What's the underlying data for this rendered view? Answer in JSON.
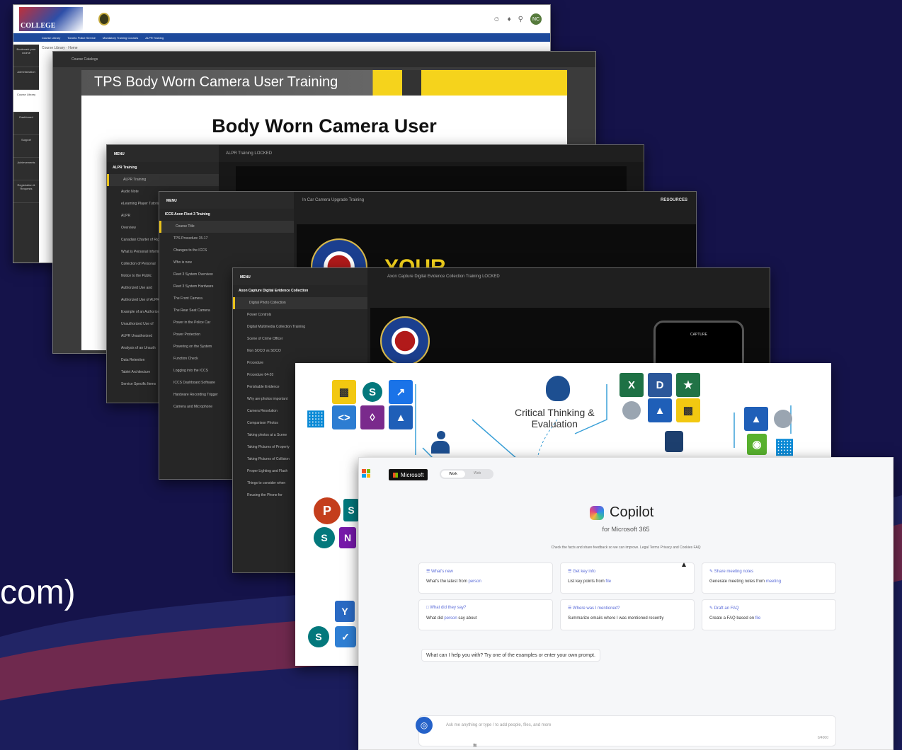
{
  "caption": "com)",
  "colors": {
    "background": "#15134a",
    "accent_yellow": "#f5d31c",
    "copilot_blue": "#2562c9"
  },
  "lms": {
    "logo_text": "COLLEGE",
    "breadcrumbs": [
      "Course Library",
      "Toronto Police Service",
      "Mandatory Training Courses",
      "ALPR Training"
    ],
    "path_label": "Course Library · Home",
    "avatar": "NC",
    "nav": [
      "Bookmark your course",
      "Administration",
      "Course Library",
      "Dashboard",
      "Support",
      "Achievements",
      "Registration & Requests"
    ]
  },
  "bwc": {
    "tab_label": "Course Catalogs",
    "header_title": "TPS Body Worn Camera User Training",
    "heading": "Body Worn Camera User"
  },
  "alpr": {
    "menu": "MENU",
    "title": "ALPR Training LOCKED",
    "section": "ALPR Training",
    "items": [
      "ALPR Training",
      "Audio Note",
      "eLearning Player Tutorial",
      "ALPR",
      "Overview",
      "Canadian Charter of Rights",
      "What is Personal Information",
      "Collection of Personal",
      "Notice to the Public",
      "Authorized Use and",
      "Authorized Use of ALPR",
      "Example of an Authorized",
      "Unauthorized Use of",
      "ALPR Unauthorized",
      "Analysis of an Unauth",
      "Data Retention",
      "Tablet Architecture",
      "Service Specific Items"
    ]
  },
  "icc": {
    "menu": "MENU",
    "title": "In Car Camera Upgrade Training",
    "resources": "RESOURCES",
    "section": "ICCS Axon Fleet 3 Training",
    "items": [
      "Course Title",
      "TPS Procedure 15-17",
      "Changes to the ICCS",
      "Who is new",
      "Fleet 3 System Overview",
      "Fleet 3 System Hardware",
      "The Front Camera",
      "The Rear Seat Camera",
      "Power in the Police Car",
      "Power Protection",
      "Powering on the System",
      "Function Check",
      "Logging into the ICCS",
      "ICCS Dashboard Software",
      "Hardware Recording Trigger",
      "Camera and Microphone"
    ],
    "banner": "YOUR"
  },
  "axon": {
    "menu": "MENU",
    "title": "Axon Capture Digital Evidence Collection Training LOCKED",
    "section": "Axon Capture Digital Evidence Collection",
    "items": [
      "Digital Photo Collection",
      "Power Controls",
      "Digital Multimedia Collection Training",
      "Scene of Crime Officer",
      "Non SOCO vs SOCO",
      "Procedure",
      "Procedure 04-20",
      "Perishable Evidence",
      "Why are photos important",
      "Camera Resolution",
      "Comparison Photos",
      "Taking photos at a Scene",
      "Taking Pictures of Property",
      "Taking Pictures of Collision",
      "Proper Lighting and Flash",
      "Things to consider when",
      "Reusing the Phone for"
    ],
    "phone_label": "CAPTURE"
  },
  "m365": {
    "center_label_1": "Critical Thinking &",
    "center_label_2": "Evaluation",
    "tiles": [
      "power-bi",
      "sharepoint",
      "remote-desktop",
      "windows",
      "dev-code",
      "power-automate",
      "azure",
      "excel",
      "word",
      "people",
      "azure-2",
      "power-bi-2",
      "azure-3",
      "security",
      "windows-2",
      "powerpoint",
      "onenote",
      "yammer",
      "planner"
    ]
  },
  "copilot": {
    "brand": "Microsoft",
    "toggle_on": "Work",
    "toggle_off": "Web",
    "title": "Copilot",
    "subtitle": "for Microsoft 365",
    "disclaimer": "Check the facts and share feedback so we can improve.  Legal Terms   Privacy and Cookies   FAQ",
    "cards": [
      {
        "title": "What's new",
        "desc": "What's the latest from ",
        "tag": "person"
      },
      {
        "title": "Get key info",
        "desc": "List key points from ",
        "tag": "file"
      },
      {
        "title": "Share meeting notes",
        "desc": "Generate meeting notes from ",
        "tag": "meeting"
      },
      {
        "title": "What did they say?",
        "desc": "What did ",
        "tag": "person",
        "tail": " say about"
      },
      {
        "title": "Where was I mentioned?",
        "desc": "Summarize emails where I was mentioned recently",
        "tag": ""
      },
      {
        "title": "Draft an FAQ",
        "desc": "Create a FAQ based on ",
        "tag": "file"
      }
    ],
    "help": "What can I help you with? Try one of the examples or enter your own prompt.",
    "input_placeholder": "Ask me anything or type / to add people, files, and more",
    "counter": "0/4000"
  }
}
